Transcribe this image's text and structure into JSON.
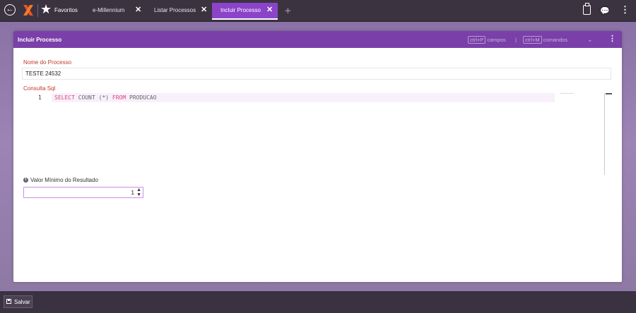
{
  "topbar": {
    "favorites_label": "Favoritos",
    "tabs": [
      {
        "label": "e-Millennium",
        "close": "✕",
        "active": false
      },
      {
        "label": "Listar Processos",
        "close": "✕",
        "active": false
      },
      {
        "label": "Incluir Processo",
        "close": "✕",
        "active": true
      }
    ],
    "add_tab": "+",
    "icons": {
      "back": "back-arrow-icon",
      "logo": "millennium-logo-icon",
      "star": "star-icon",
      "clipboard": "clipboard-check-icon",
      "chat": "chat-icon",
      "menu": "vertical-dots-icon"
    }
  },
  "panel": {
    "title": "Incluir Processo",
    "hint_fields_key": "ctrl+P",
    "hint_fields_label": "campos",
    "hint_separator": "|",
    "hint_commands_key": "ctrl+M",
    "hint_commands_label": "comandos"
  },
  "form": {
    "nome_label": "Nome do Processo",
    "nome_value": "TESTE 24532",
    "sql_label": "Consulta Sql",
    "sql_line_number": "1",
    "sql_keyword_select": "SELECT",
    "sql_count": "COUNT (*)",
    "sql_keyword_from": "FROM",
    "sql_table": "PRODUCAO",
    "valor_label": "Valor Mínimo do Resultado",
    "valor_value": "1"
  },
  "footer": {
    "save_label": "Salvar"
  },
  "colors": {
    "accent": "#8b43c8",
    "header": "#7a3fa8",
    "label_red": "#c0392b",
    "sql_keyword": "#e0457b"
  }
}
